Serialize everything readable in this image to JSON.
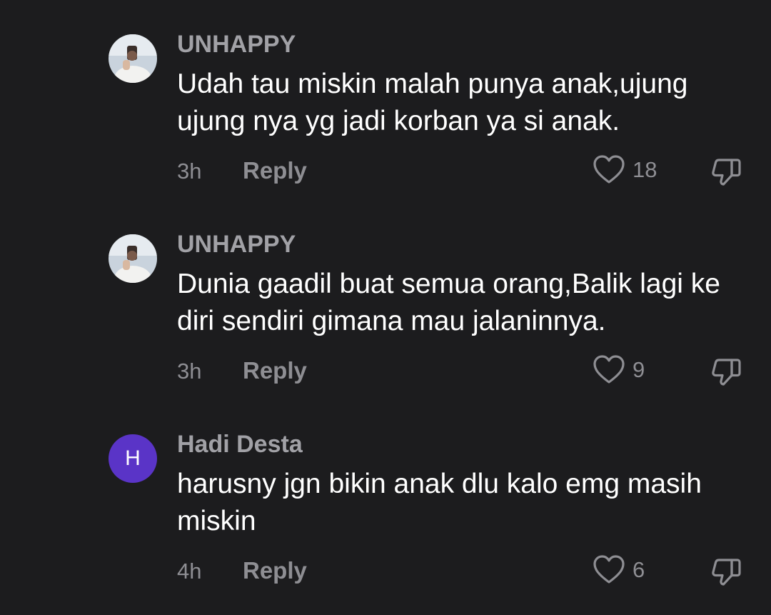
{
  "comments": [
    {
      "username": "UNHAPPY",
      "avatar_icon": "profile-photo",
      "text": "Udah tau miskin malah punya anak,ujung ujung nya yg jadi korban ya si anak.",
      "time": "3h",
      "reply_label": "Reply",
      "likes": "18"
    },
    {
      "username": "UNHAPPY",
      "avatar_icon": "profile-photo",
      "text": "Dunia gaadil buat semua orang,Balik lagi ke diri sendiri gimana mau jalaninnya.",
      "time": "3h",
      "reply_label": "Reply",
      "likes": "9"
    },
    {
      "username": "Hadi Desta",
      "avatar_letter": "H",
      "avatar_color": "#5a34c7",
      "text": "harusny jgn bikin anak dlu kalo emg masih miskin",
      "time": "4h",
      "reply_label": "Reply",
      "likes": "6"
    }
  ]
}
